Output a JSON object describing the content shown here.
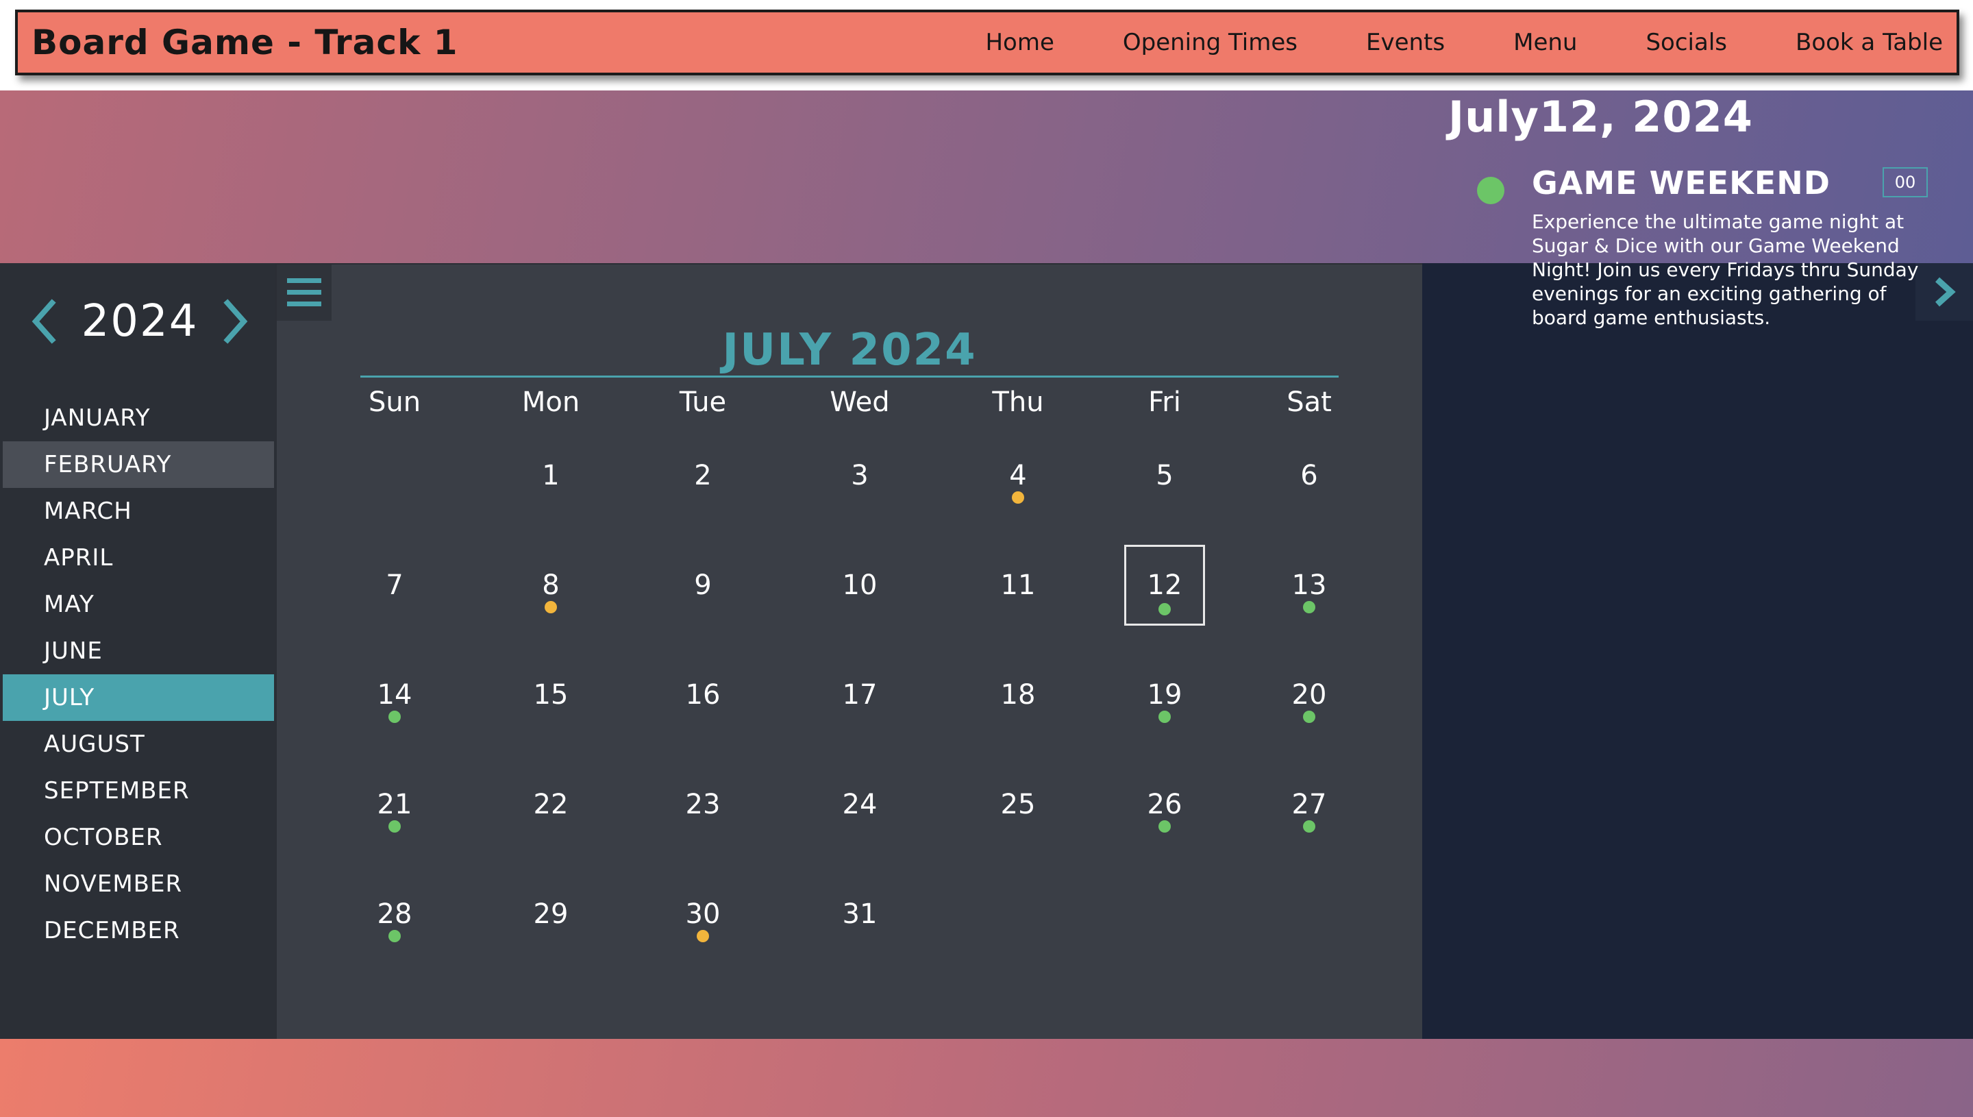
{
  "nav": {
    "brand": "Board Game - Track 1",
    "links": [
      "Home",
      "Opening Times",
      "Events",
      "Menu",
      "Socials",
      "Book a Table"
    ]
  },
  "sidebar": {
    "year": "2024",
    "prev_icon": "chevron-left-icon",
    "next_icon": "chevron-right-icon",
    "months": [
      "JANUARY",
      "FEBRUARY",
      "MARCH",
      "APRIL",
      "MAY",
      "JUNE",
      "JULY",
      "AUGUST",
      "SEPTEMBER",
      "OCTOBER",
      "NOVEMBER",
      "DECEMBER"
    ],
    "active_month": "JULY",
    "hover_month": "FEBRUARY"
  },
  "calendar": {
    "title": "JULY 2024",
    "menu_icon": "hamburger-menu-icon",
    "weekdays": [
      "Sun",
      "Mon",
      "Tue",
      "Wed",
      "Thu",
      "Fri",
      "Sat"
    ],
    "first_weekday_index": 1,
    "days_in_month": 31,
    "selected_day": 12,
    "events": {
      "4": "yellow",
      "8": "yellow",
      "30": "yellow",
      "12": "green",
      "13": "green",
      "14": "green",
      "19": "green",
      "20": "green",
      "21": "green",
      "26": "green",
      "27": "green",
      "28": "green"
    }
  },
  "detail": {
    "toggle_icon": "chevron-right-icon",
    "date": "July12, 2024",
    "event_title": "GAME WEEKEND",
    "event_badge": "00",
    "event_dot_color": "green",
    "event_description": "Experience the ultimate game night at Sugar & Dice with our Game Weekend Night! Join us every Fridays thru Sunday evenings for an exciting gathering of board game enthusiasts."
  },
  "colors": {
    "accent": "#4aa3ad",
    "nav_bg": "#ef7a6a",
    "dot_yellow": "#f2b53c",
    "dot_green": "#6cc567",
    "main_bg": "#3a3e46",
    "sidebar_bg": "#2b2f36",
    "detail_bg": "#1b2337"
  }
}
